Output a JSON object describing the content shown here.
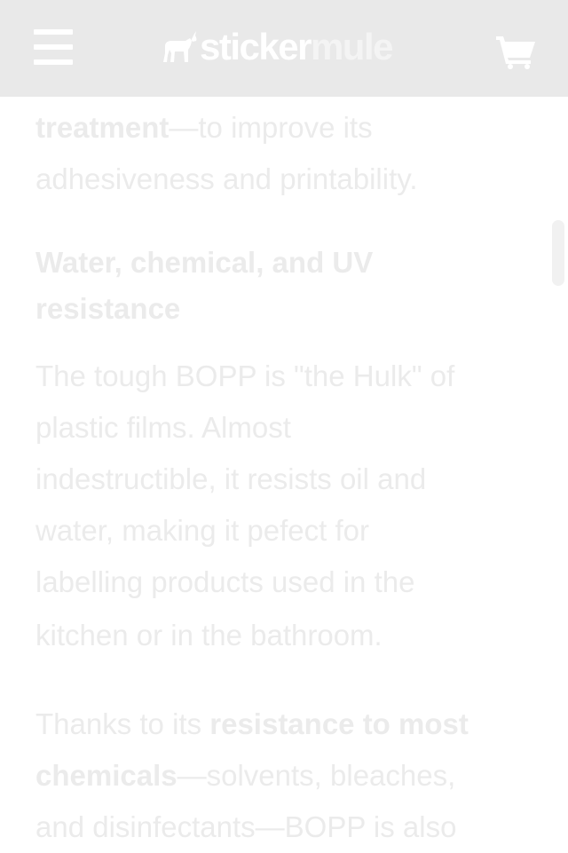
{
  "header": {
    "logo": {
      "part1": "sticker",
      "part2": "mule"
    },
    "menu_icon": "hamburger-menu-icon",
    "cart_icon": "shopping-cart-icon"
  },
  "article": {
    "intro": {
      "bold": "treatment",
      "line1_rest": "—to improve its",
      "line2": "adhesiveness and printability."
    },
    "heading": {
      "line1": "Water, chemical, and UV",
      "line2": "resistance"
    },
    "paragraph1": {
      "lines": [
        "The tough BOPP is \"the Hulk\" of",
        "plastic films. Almost",
        "indestructible, it resists oil and",
        "water, making it pefect for",
        "labelling products used in the",
        "kitchen or in the bathroom."
      ]
    },
    "paragraph2": {
      "line1_normal": "Thanks to its ",
      "line1_bold": "resistance to most",
      "line2_bold": "chemicals",
      "line2_rest": "—solvents, bleaches,",
      "line3": "and disinfectants—BOPP is also"
    }
  },
  "colors": {
    "header_bg": "#e9e9e9",
    "text_faded": "#ebebeb",
    "page_bg": "#ffffff"
  }
}
